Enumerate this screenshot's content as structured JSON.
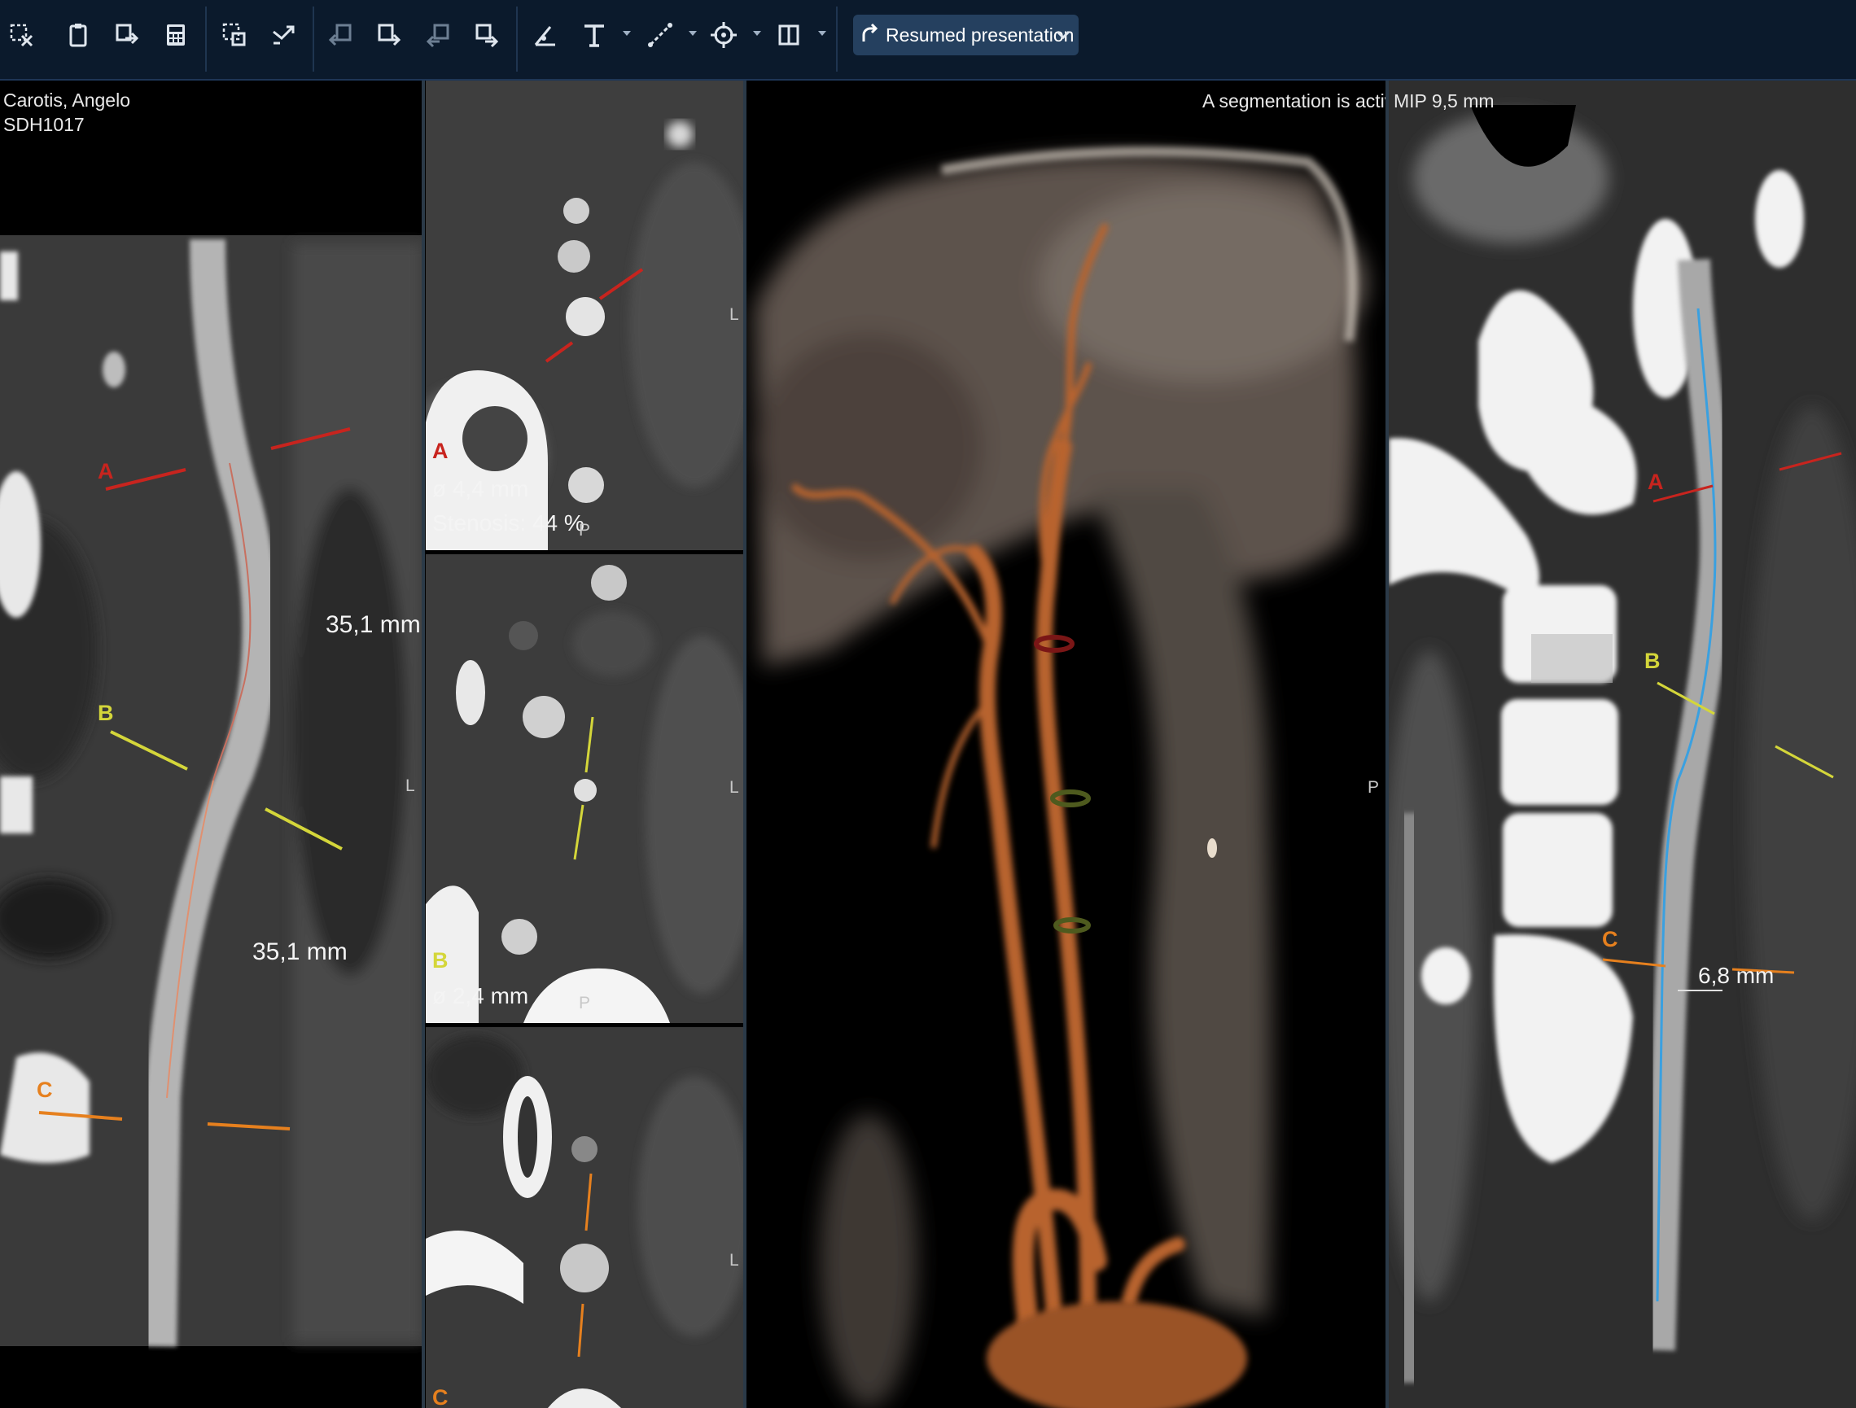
{
  "toolbar": {
    "icons": [
      "close-selection-icon",
      "clipboard-icon",
      "export-icon",
      "calculator-icon",
      "select-region-icon",
      "flip-icon",
      "prev-series-icon",
      "next-series-icon",
      "prev-image-icon",
      "next-image-icon",
      "measure-angle-icon",
      "text-icon",
      "line-tool-icon",
      "crosshair-icon",
      "layout-icon"
    ],
    "presentation_label": "Resumed presentation"
  },
  "patient": {
    "name": "Carotis, Angelo",
    "id": "SDH1017"
  },
  "curved_view": {
    "markers": {
      "a": "A",
      "b": "B",
      "c": "C"
    },
    "length_upper": "35,1 mm",
    "length_lower": "35,1 mm",
    "orientation": "L"
  },
  "cross_a": {
    "marker": "A",
    "diameter": "ø 4,4 mm",
    "stenosis": "Stenosis: 44 %",
    "orient_right": "L",
    "orient_bottom": "P"
  },
  "cross_b": {
    "marker": "B",
    "diameter": "ø 2,4 mm",
    "orient_right": "L",
    "orient_bottom": "P"
  },
  "cross_c": {
    "marker": "C",
    "orient_right": "L"
  },
  "volume_view": {
    "status": "A segmentation is active",
    "orientation": "P"
  },
  "mip_view": {
    "label": "MIP 9,5 mm",
    "markers": {
      "a": "A",
      "b": "B",
      "c": "C"
    },
    "measurement": "6,8 mm"
  },
  "colors": {
    "toolbar_bg": "#0b1a2c",
    "marker_a": "#c8241e",
    "marker_b": "#d4d63a",
    "marker_c": "#e6801e",
    "centerline": "#3aa0e0",
    "vessel_3d": "#b8642e"
  }
}
